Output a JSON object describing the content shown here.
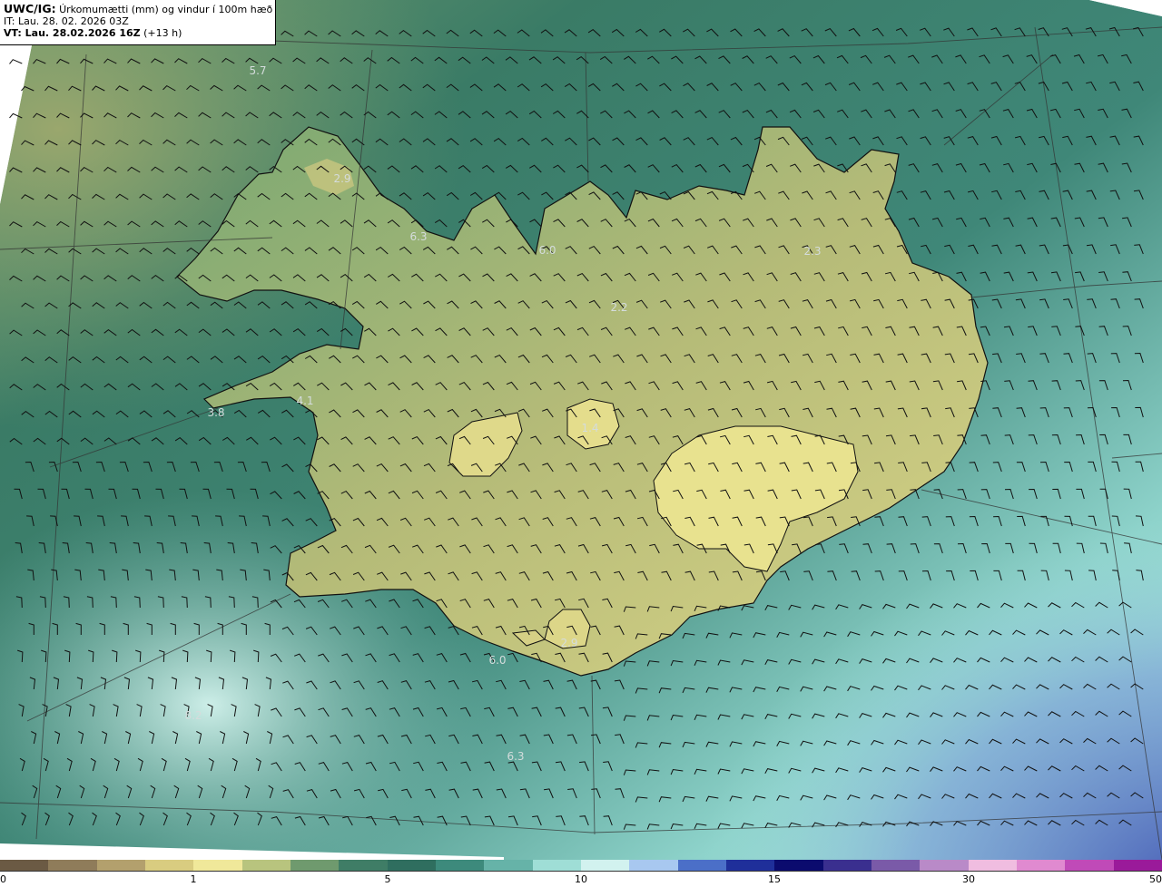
{
  "header": {
    "model": "UWC/IG:",
    "description": "Úrkomumætti (mm) og vindur í 100m hæð",
    "issue_time": "IT: Lau. 28. 02. 2026 03Z",
    "valid_time_label": "VT: Lau. 28.02.2026 16Z",
    "valid_time_offset": "(+13 h)"
  },
  "colorbar": {
    "ticks": [
      "0",
      "1",
      "5",
      "10",
      "15",
      "30",
      "50"
    ],
    "colors": [
      "#6b5a44",
      "#8f7c5a",
      "#b3a06d",
      "#d9cc80",
      "#f0e89a",
      "#b8c47e",
      "#6f9a6e",
      "#3f7d66",
      "#2f6e5f",
      "#3d8a7c",
      "#66b3a8",
      "#9fded6",
      "#d2f2ef",
      "#a8c8f0",
      "#4b6fc8",
      "#1f2f9a",
      "#0b0b6e",
      "#3a2f8f",
      "#7a5aa8",
      "#b98ac8",
      "#f0bde0",
      "#e08ad0",
      "#c04ab8",
      "#9a1a9a"
    ]
  },
  "map_values": [
    {
      "id": "v1",
      "text": "5.7"
    },
    {
      "id": "v2",
      "text": "2.9"
    },
    {
      "id": "v3",
      "text": "6.3"
    },
    {
      "id": "v4",
      "text": "6.0"
    },
    {
      "id": "v5",
      "text": "2.3"
    },
    {
      "id": "v6",
      "text": "2.2"
    },
    {
      "id": "v7",
      "text": "4.1"
    },
    {
      "id": "v8",
      "text": "3.8"
    },
    {
      "id": "v9",
      "text": "1.4"
    },
    {
      "id": "v10",
      "text": "2.9"
    },
    {
      "id": "v11",
      "text": "6.0"
    },
    {
      "id": "v12",
      "text": "6.3"
    },
    {
      "id": "v13",
      "text": "8.2"
    }
  ],
  "colors": {
    "ocean_low": "#2f6e5f",
    "land_high": "#e8e28f",
    "ocean_high": "#bfeee8",
    "deep": "#3c4fb0"
  }
}
